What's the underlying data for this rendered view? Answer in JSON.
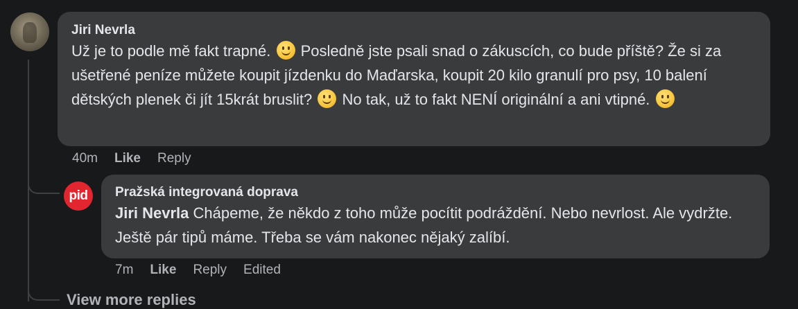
{
  "comment": {
    "author": "Jiri Nevrla",
    "text_parts": [
      "Už je to podle mě fakt trapné.",
      "Posledně jste psali snad o zákuscích, co bude příště? Že si za ušetřené peníze můžete koupit jízdenku do Maďarska, koupit 20 kilo granulí pro psy, 10 balení dětských plenek či jít 15krát bruslit?",
      "No tak, už to fakt NENÍ originální a ani vtipné."
    ],
    "emoji": "slightly-smiling-face-icon",
    "time": "40m",
    "like_label": "Like",
    "reply_label": "Reply"
  },
  "reply": {
    "author": "Pražská integrovaná doprava",
    "avatar_text": "pid",
    "mention": "Jiri Nevrla",
    "text": "Chápeme, že někdo z toho může pocítit podráždění. Nebo nevrlost. Ale vydržte. Ještě pár tipů máme. Třeba se vám nakonec nějaký zalíbí.",
    "time": "7m",
    "like_label": "Like",
    "reply_label": "Reply",
    "edited_label": "Edited"
  },
  "view_more": "View more replies",
  "colors": {
    "background": "#18191a",
    "bubble": "#3a3b3c",
    "text": "#e4e6eb",
    "muted": "#b0b3b8",
    "pid_red": "#e2262f"
  }
}
